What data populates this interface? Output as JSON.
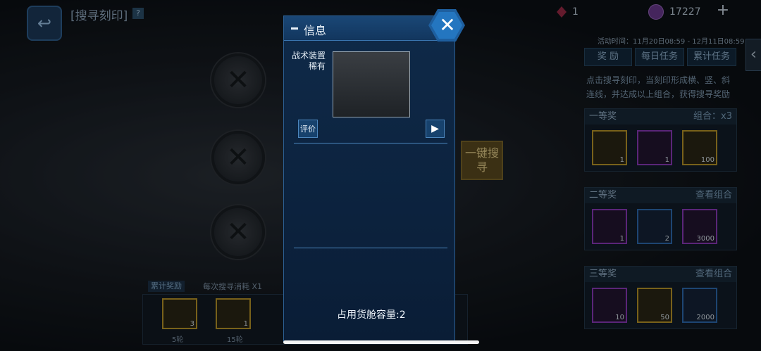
{
  "header": {
    "title": "[搜寻刻印]",
    "badge": "?",
    "gem_count": "1",
    "coin_count": "17227",
    "plus": "+"
  },
  "event": {
    "time": "活动时间：11月20日08:59 - 12月11日08:59",
    "tabs": [
      "奖 励",
      "每日任务",
      "累计任务"
    ],
    "description": "点击搜寻刻印，当刻印形成横、竖、斜连线，并达成以上组合，获得搜寻奖励"
  },
  "search_button": "一键搜寻",
  "prizes": [
    {
      "title": "一等奖",
      "right": "组合：x3",
      "items": [
        {
          "count": "1",
          "tier": "yellow"
        },
        {
          "count": "1",
          "tier": "purple"
        },
        {
          "count": "100",
          "tier": "yellow"
        }
      ]
    },
    {
      "title": "二等奖",
      "right": "查看组合",
      "items": [
        {
          "count": "1",
          "tier": "purple"
        },
        {
          "count": "2",
          "tier": "blue"
        },
        {
          "count": "3000",
          "tier": "purple"
        }
      ]
    },
    {
      "title": "三等奖",
      "right": "查看组合",
      "items": [
        {
          "count": "10",
          "tier": "purple"
        },
        {
          "count": "50",
          "tier": "yellow"
        },
        {
          "count": "2000",
          "tier": "blue"
        }
      ]
    }
  ],
  "bottom": {
    "label": "累计奖励",
    "consume": "每次搜寻消耗",
    "consume_qty": "X1",
    "rewards": [
      {
        "count": "3",
        "rounds": "5轮"
      },
      {
        "count": "1",
        "rounds": "15轮"
      }
    ]
  },
  "dialog": {
    "title": "信息",
    "close": "✕",
    "item_type": "战术装置",
    "item_rarity": "稀有",
    "eval_label": "评价",
    "play_label": "▶",
    "capacity": "占用货舱容量:2"
  },
  "colors": {
    "accent": "#2476c0",
    "dialog_bg": "#0d2440",
    "yellow_tier": "#b89628",
    "purple_tier": "#8a39b8",
    "blue_tier": "#2d6bb0"
  }
}
